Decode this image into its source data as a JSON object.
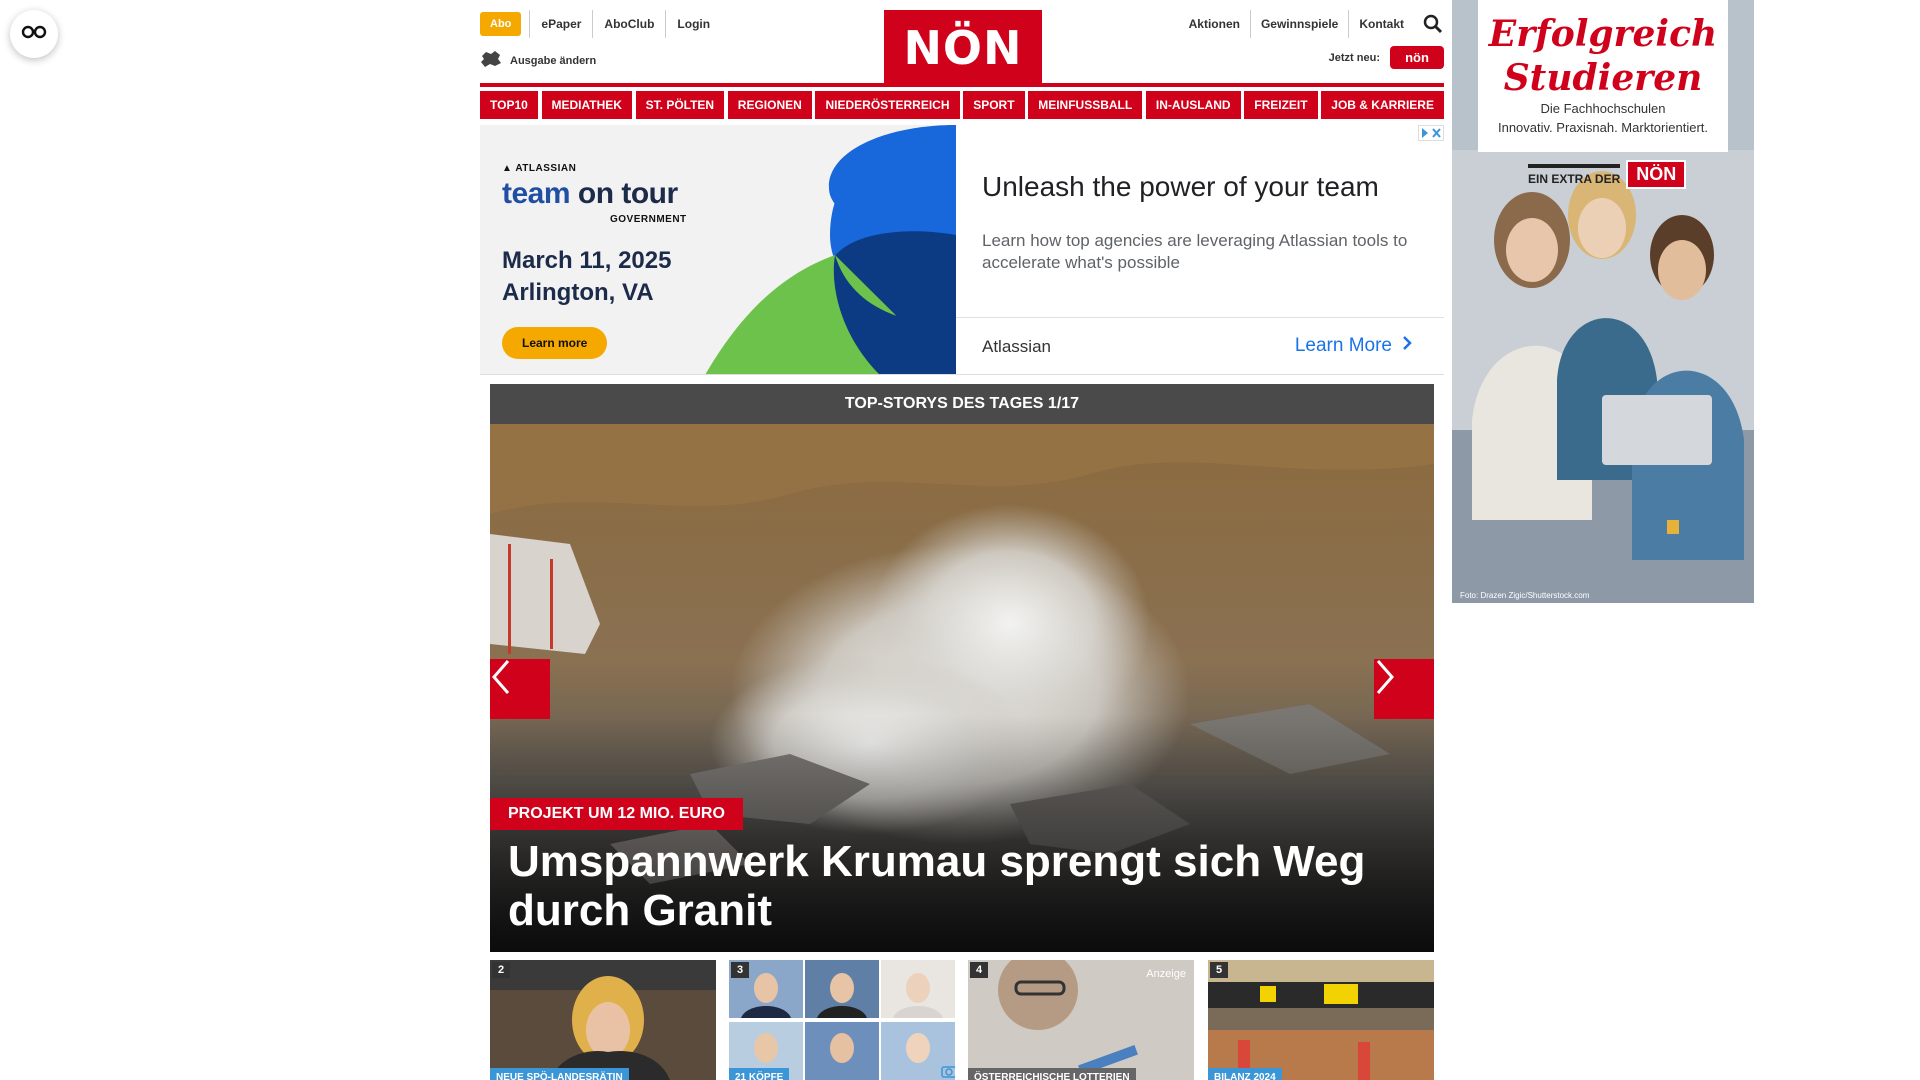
{
  "colors": {
    "brand_red": "#d0021b",
    "abo_orange": "#f5a800",
    "nav_gray": "#4a4a4a",
    "tag_blue": "#3a96d6"
  },
  "reader": {
    "icon": "reader-glasses-icon"
  },
  "header": {
    "abo_label": "Abo",
    "left_links": [
      "ePaper",
      "AboClub",
      "Login"
    ],
    "ausgabe_label": "Ausgabe ändern",
    "logo_text": "NÖN",
    "right_links": [
      "Aktionen",
      "Gewinnspiele",
      "Kontakt"
    ],
    "jetzt_label": "Jetzt neu:",
    "jetzt_badge": "nön"
  },
  "nav": {
    "items": [
      "TOP10",
      "MEDIATHEK",
      "ST. PÖLTEN",
      "REGIONEN",
      "NIEDERÖSTERREICH",
      "SPORT",
      "MEINFUSSBALL",
      "IN-AUSLAND",
      "FREIZEIT",
      "JOB & KARRIERE"
    ]
  },
  "ad_banner": {
    "brand": "ATLASSIAN",
    "team_a": "team",
    "team_b": " on tour",
    "government": "GOVERNMENT",
    "date": "March 11, 2025",
    "location": "Arlington, VA",
    "cta": "Learn more",
    "headline": "Unleash the power of your team",
    "description": "Learn how top agencies are leveraging Atlassian tools to accelerate what's possible",
    "advertiser": "Atlassian",
    "learn_more": "Learn More"
  },
  "top_stories": {
    "heading": "TOP-STORYS DES TAGES 1/17",
    "kicker": "PROJEKT UM 12 MIO. EURO",
    "title": "Umspannwerk Krumau sprengt sich Weg durch Granit"
  },
  "thumbs": [
    {
      "num": "2",
      "tag": "NEUE SPÖ-LANDESRÄTIN"
    },
    {
      "num": "3",
      "tag": "21 KÖPFE"
    },
    {
      "num": "4",
      "tag": "ÖSTERREICHISCHE LOTTERIEN",
      "anzeige": "Anzeige"
    },
    {
      "num": "5",
      "tag": "BILANZ 2024"
    }
  ],
  "side_ad": {
    "title_1": "Erfolgreich",
    "title_2": "Studieren",
    "sub_1": "Die Fachhochschulen",
    "sub_2": "Innovativ. Praxisnah. Marktorientiert.",
    "extra": "EIN EXTRA DER",
    "badge": "NÖN",
    "foto": "Foto: Drazen Zigic/Shutterstock.com"
  }
}
